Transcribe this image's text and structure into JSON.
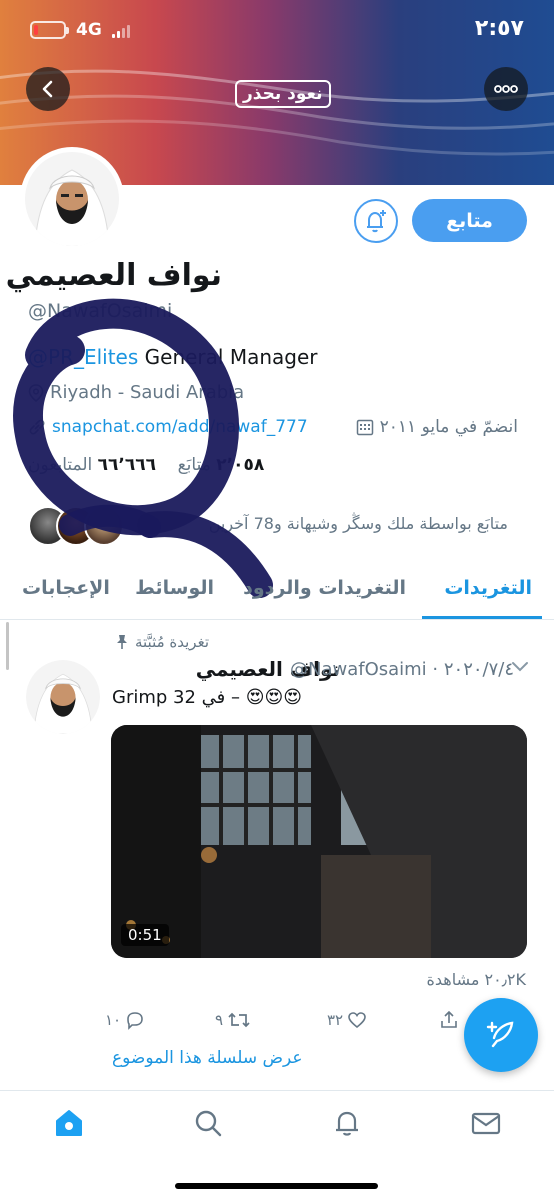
{
  "status_bar": {
    "time": "٢:٥٧",
    "network": "4G",
    "battery_level": 0.15
  },
  "header": {
    "brand_logo_text": "نعود بحذر"
  },
  "profile": {
    "display_name": "نواف العصيمي",
    "handle": "@NawafOsaimi",
    "follow_button": "متابع",
    "bio_link_text": "@PR_Elites",
    "bio_text": " General Manager",
    "location": "Riyadh - Saudi Arabia",
    "website": "snapchat.com/add/nawaf_777",
    "joined": "انضمّ في مايو ٢٠١١",
    "following_count": "٢٬٠٥٨",
    "following_label": "متابَع",
    "followers_count": "٦٦٬٦٦٦",
    "followers_label": "المتابعون",
    "followed_by": "متابَع بواسطة ملك وسڴر وشيهانة و78 آخرين"
  },
  "tabs": [
    {
      "label": "التغريدات",
      "active": true
    },
    {
      "label": "التغريدات والردود",
      "active": false
    },
    {
      "label": "الوسائط",
      "active": false
    },
    {
      "label": "الإعجابات",
      "active": false
    }
  ],
  "tweet": {
    "pinned_label": "تغريدة مُثبَّتة",
    "author_name": "نواف العصيمي",
    "handle_date": "@NawafOsaimi · ٢٠٢٠/٧/٤",
    "text": "😍😍😍 – في Grimp 32",
    "video_duration": "0:51",
    "views": "٢٠٫٢K مشاهدة",
    "replies": "١٠",
    "retweets": "٩",
    "likes": "٣٢",
    "thread_link": "عرض سلسلة هذا الموضوع"
  },
  "colors": {
    "accent": "#1b95e0",
    "follow_button": "#4a9ef0",
    "fab": "#1da1f2",
    "scribble": "#1a1a5c"
  },
  "icons": {
    "back": "chevron-left-icon",
    "more": "more-dots-icon",
    "bell": "bell-plus-icon",
    "location": "location-pin-icon",
    "link": "link-icon",
    "calendar": "calendar-icon",
    "pin": "pin-icon",
    "reply": "reply-icon",
    "retweet": "retweet-icon",
    "like": "heart-icon",
    "share": "share-icon",
    "compose": "compose-icon",
    "nav": [
      "home-icon",
      "search-icon",
      "notifications-icon",
      "messages-icon"
    ]
  }
}
